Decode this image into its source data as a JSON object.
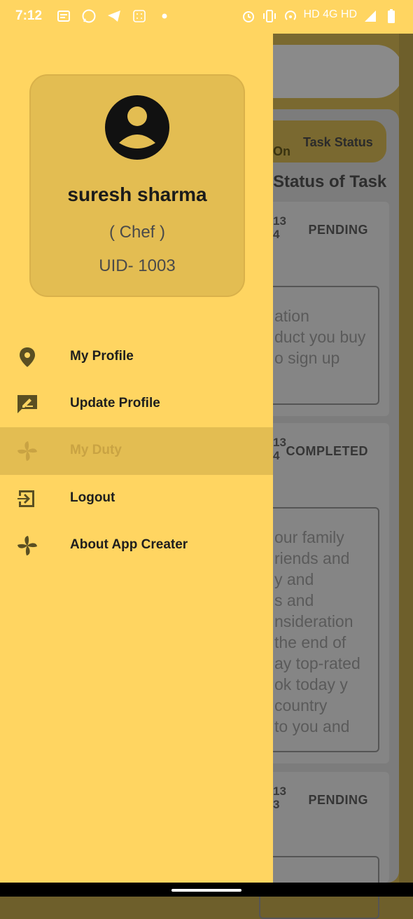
{
  "status_bar": {
    "time": "7:12",
    "right_text": "HD 4G HD"
  },
  "background": {
    "pill_on": "On",
    "pill_status": "Task Status",
    "heading": "Status of Task",
    "cards": [
      {
        "date_line1": "13",
        "date_line2": "4",
        "status": "PENDING",
        "desc": [
          "ation",
          "duct you buy",
          "o sign up"
        ]
      },
      {
        "date_line1": "13",
        "date_line2": "4",
        "status": "COMPLETED",
        "desc": [
          "our family",
          "riends and",
          "y and",
          "s and",
          "nsideration",
          "the end of",
          "ay top-rated",
          "ok today y",
          "country",
          "to you and"
        ]
      },
      {
        "date_line1": "13",
        "date_line2": "3",
        "status": "PENDING",
        "desc": []
      }
    ]
  },
  "drawer": {
    "profile": {
      "name": "suresh sharma",
      "role": "( Chef )",
      "uid": "UID- 1003"
    },
    "menu": [
      {
        "label": "My Profile",
        "icon": "location-pin-icon",
        "active": false
      },
      {
        "label": "Update Profile",
        "icon": "edit-message-icon",
        "active": false
      },
      {
        "label": "My Duty",
        "icon": "pinwheel-icon",
        "active": true
      },
      {
        "label": "Logout",
        "icon": "logout-icon",
        "active": false
      },
      {
        "label": "About App Creater",
        "icon": "pinwheel-icon",
        "active": false
      }
    ]
  },
  "colors": {
    "drawer_bg": "#ffd561",
    "card_bg": "#e3bd52",
    "text_dark": "#1e1e1e"
  }
}
